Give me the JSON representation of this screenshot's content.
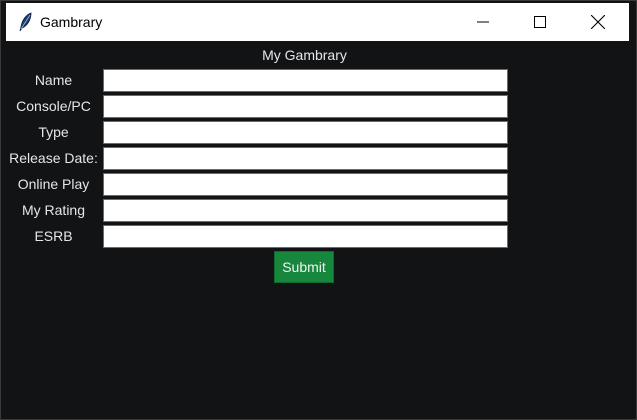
{
  "window": {
    "title": "Gambrary",
    "icon": "feather-icon"
  },
  "main": {
    "heading": "My Gambrary",
    "fields": [
      {
        "label": "Name",
        "value": ""
      },
      {
        "label": "Console/PC",
        "value": ""
      },
      {
        "label": "Type",
        "value": ""
      },
      {
        "label": "Release Date:",
        "value": ""
      },
      {
        "label": "Online Play",
        "value": ""
      },
      {
        "label": "My Rating",
        "value": ""
      },
      {
        "label": "ESRB",
        "value": ""
      }
    ],
    "submit_label": "Submit"
  },
  "colors": {
    "background": "#121314",
    "submit": "#16873c",
    "text": "#e6e6e6"
  }
}
